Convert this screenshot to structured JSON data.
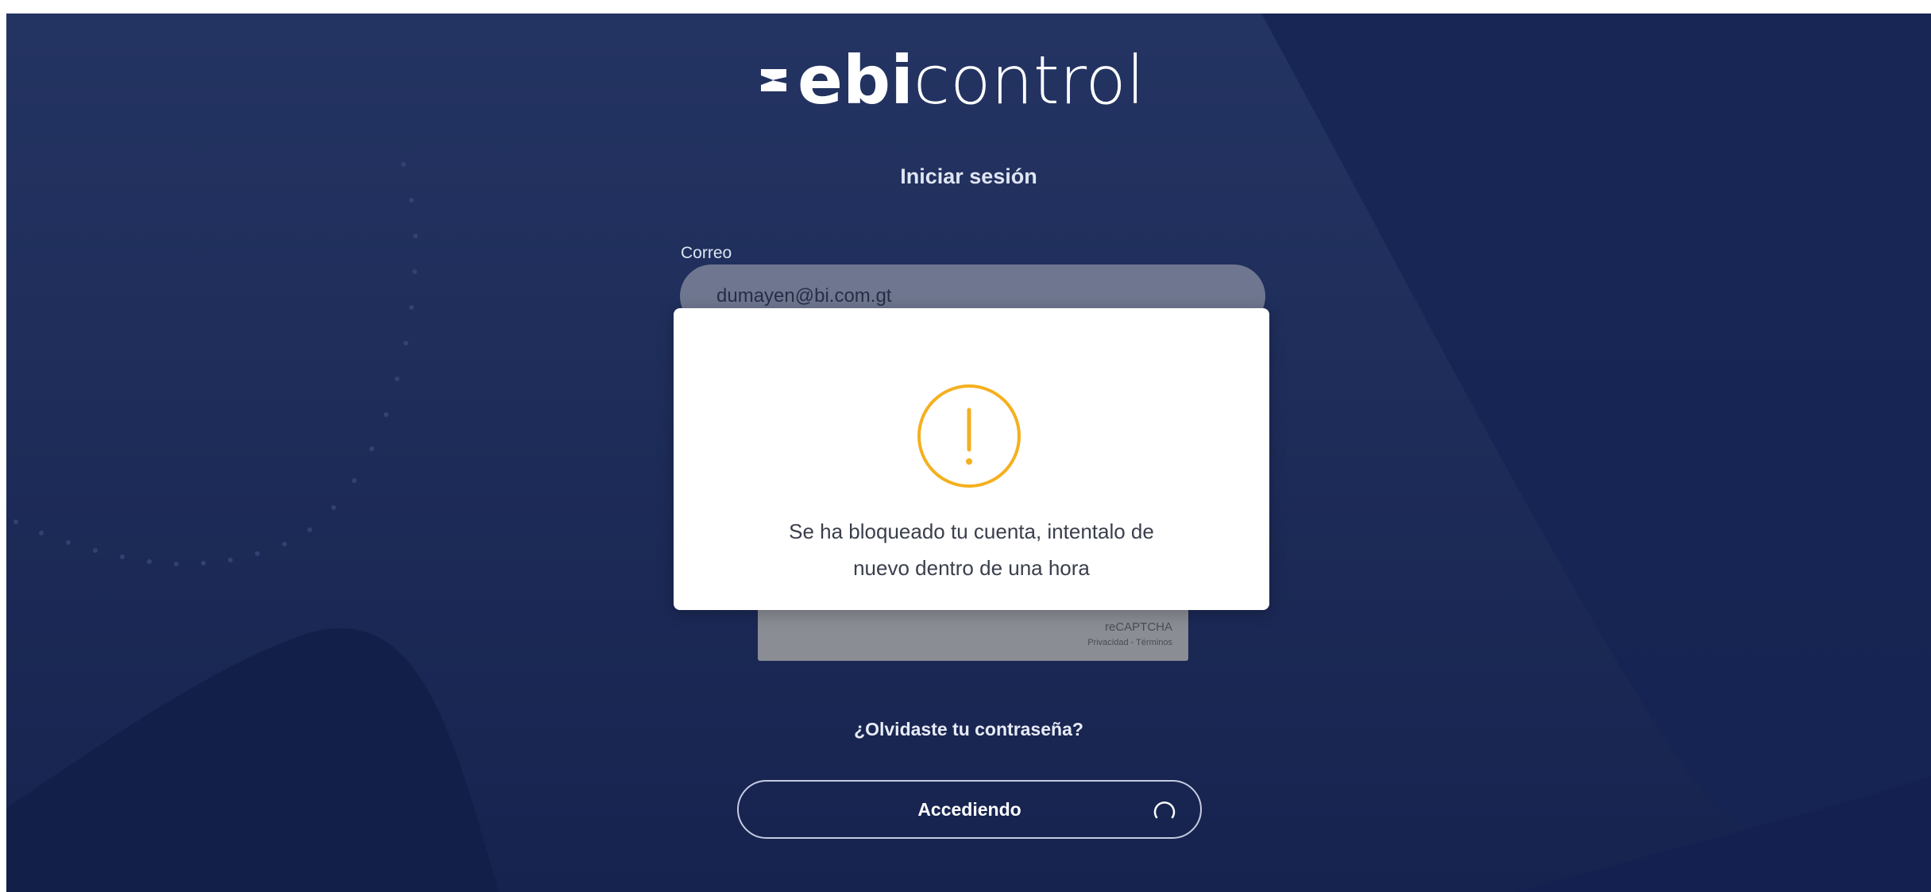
{
  "brand": {
    "name_bold": "ebi",
    "name_light": "control"
  },
  "login": {
    "title": "Iniciar sesión",
    "email_label": "Correo",
    "email_value": "dumayen@bi.com.gt",
    "forgot_password": "¿Olvidaste tu contraseña?",
    "submit_label": "Accediendo"
  },
  "recaptcha": {
    "name": "reCAPTCHA",
    "links": "Privacidad - Términos"
  },
  "modal": {
    "icon": "warning-icon",
    "message_line1": "Se ha bloqueado tu cuenta, intentalo de",
    "message_line2": "nuevo dentro de una hora"
  },
  "colors": {
    "background": "#1d2c5c",
    "warning": "#f5b01f",
    "modal_background": "#ffffff"
  }
}
